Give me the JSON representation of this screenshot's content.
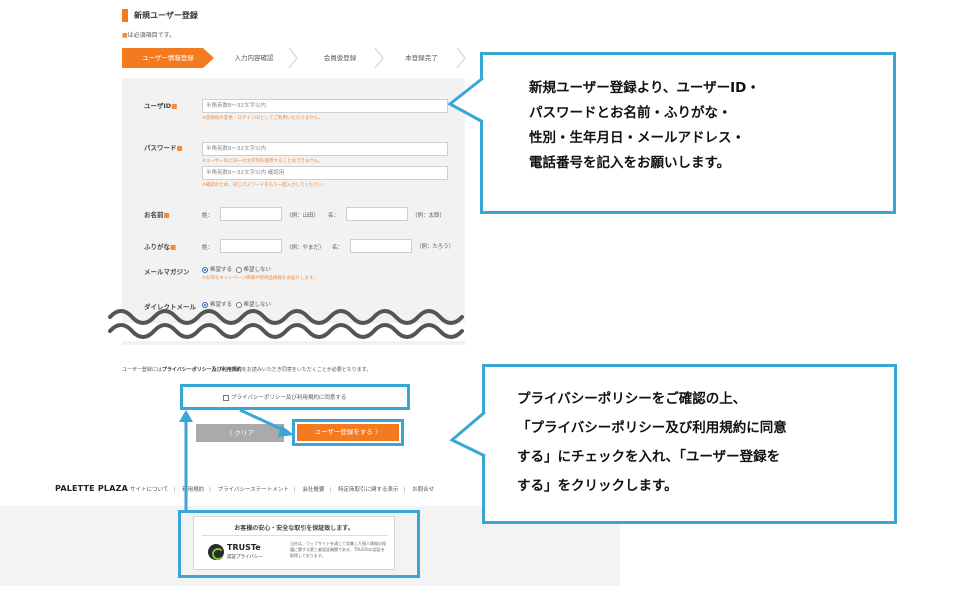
{
  "header": {
    "title": "新規ユーザー登録",
    "required_note_mark": "■",
    "required_note": "は必須項目です。"
  },
  "steps": [
    "ユーザー情報登録",
    "入力内容確認",
    "会員仮登録",
    "本登録完了"
  ],
  "form": {
    "user_id": {
      "label": "ユーザID",
      "required_mark": "■",
      "placeholder": "半角英数8～32文字以内",
      "hint": "※登録後の変更・ログインIDとしてご利用いただけません。"
    },
    "password": {
      "label": "パスワード",
      "required_mark": "■",
      "placeholder": "半角英数8～32文字以内",
      "hint": "※ユーザーIDと同一の文字列を使用することはできません。",
      "confirm_placeholder": "半角英数8～32文字以内 確認用",
      "confirm_hint": "※確認のため、同じパスワードをもう一度入力してください。"
    },
    "name": {
      "label": "お名前",
      "required_mark": "■",
      "last_label": "姓：",
      "last_example": "（例：山田）",
      "first_label": "名：",
      "first_example": "（例：太郎）"
    },
    "furigana": {
      "label": "ふりがな",
      "required_mark": "■",
      "last_label": "姓：",
      "last_example": "（例：やまだ）",
      "first_label": "名：",
      "first_example": "（例：たろう）"
    },
    "mail_magazine": {
      "label": "メールマガジン",
      "options": [
        "希望する",
        "希望しない"
      ],
      "selected": "希望する",
      "hint": "※お得なキャンペーン情報や新商品情報をお届けします。"
    },
    "direct_mail": {
      "label": "ダイレクトメール",
      "options": [
        "希望する",
        "希望しない"
      ],
      "selected": "希望する"
    }
  },
  "agreement": {
    "note_prefix": "ユーザー登録には",
    "note_bold": "プライバシーポリシー及び利用規約",
    "note_suffix": "をお読みいただき同意をいただくことが必要となります。",
    "checkbox_label": "プライバシーポリシー及び利用規約に同意する"
  },
  "buttons": {
    "clear": "〈 クリア",
    "register": "ユーザー登録をする 〉"
  },
  "footer": {
    "logo": "PALETTE PLAZA",
    "links": [
      "サイトについて",
      "利用規約",
      "プライバシーステートメント",
      "会社概要",
      "特定商取引に関する表示",
      "お問合せ"
    ]
  },
  "trust": {
    "heading": "お客様の安心・安全な取引を保証致します。",
    "brand": "TRUSTe",
    "sub": "認証プライバシー",
    "description": "当社は、ウェブサイトを通じて収集した個人情報の保護に関する第三者認証機関である、TRUSTeの認証を取得しております。"
  },
  "callouts": {
    "top": [
      "新規ユーザー登録より、ユーザーID・",
      "パスワードとお名前・ふりがな・",
      "性別・生年月日・メールアドレス・",
      "電話番号を記入をお願いします。"
    ],
    "bottom": [
      "プライバシーポリシーをご確認の上、",
      "「プライバシーポリシー及び利用規約に同意",
      "する」にチェックを入れ、「ユーザー登録を",
      "する」をクリックします。"
    ]
  },
  "colors": {
    "accent_orange": "#f47a20",
    "annotation_blue": "#3aa6d6"
  }
}
